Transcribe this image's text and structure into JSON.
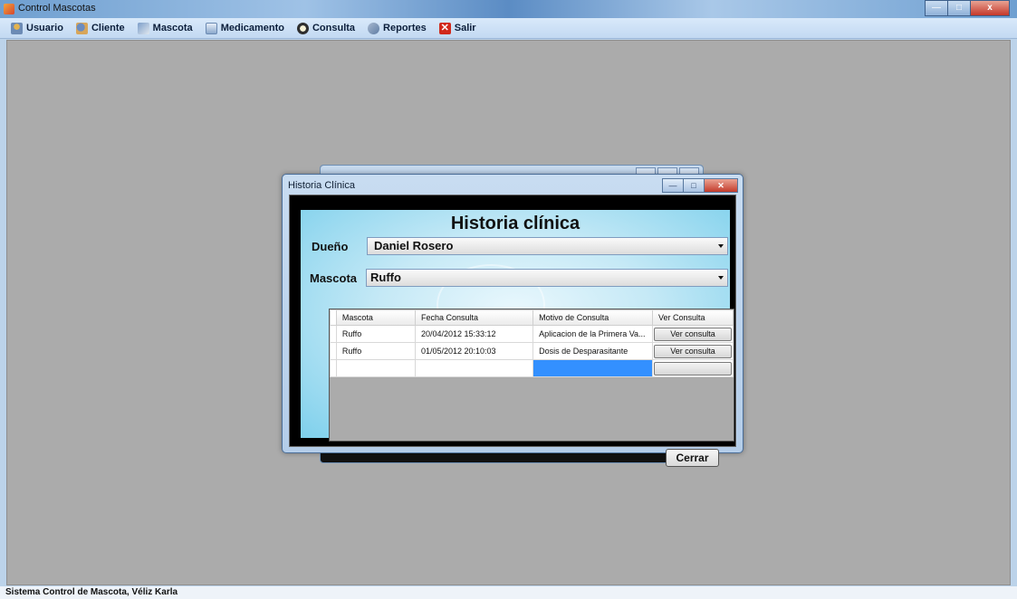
{
  "app": {
    "title": "Control Mascotas",
    "controls": {
      "minimize": "—",
      "maximize": "□",
      "close": "x"
    }
  },
  "menu": {
    "items": [
      {
        "label": "Usuario",
        "icon": "user-icon"
      },
      {
        "label": "Cliente",
        "icon": "client-icon"
      },
      {
        "label": "Mascota",
        "icon": "pet-icon"
      },
      {
        "label": "Medicamento",
        "icon": "medicine-icon"
      },
      {
        "label": "Consulta",
        "icon": "consult-icon"
      },
      {
        "label": "Reportes",
        "icon": "reports-icon"
      },
      {
        "label": "Salir",
        "icon": "exit-icon"
      }
    ]
  },
  "status": {
    "text": "Sistema Control de Mascota, Véliz Karla"
  },
  "dialog": {
    "title": "Historia Clínica",
    "heading": "Historia clínica",
    "owner_label": "Dueño",
    "owner_value": "Daniel Rosero",
    "pet_label": "Mascota",
    "pet_value": "Ruffo",
    "close_button": "Cerrar",
    "grid": {
      "columns": [
        "Mascota",
        "Fecha Consulta",
        "Motivo de Consulta",
        "Ver Consulta"
      ],
      "rows": [
        {
          "mascota": "Ruffo",
          "fecha": "20/04/2012 15:33:12",
          "motivo": "Aplicacion de la Primera Va...",
          "ver": "Ver consulta"
        },
        {
          "mascota": "Ruffo",
          "fecha": "01/05/2012 20:10:03",
          "motivo": "Dosis de Desparasitante",
          "ver": "Ver consulta"
        }
      ]
    }
  },
  "colors": {
    "selection": "#3390ff",
    "mdi_background": "#ababab"
  }
}
